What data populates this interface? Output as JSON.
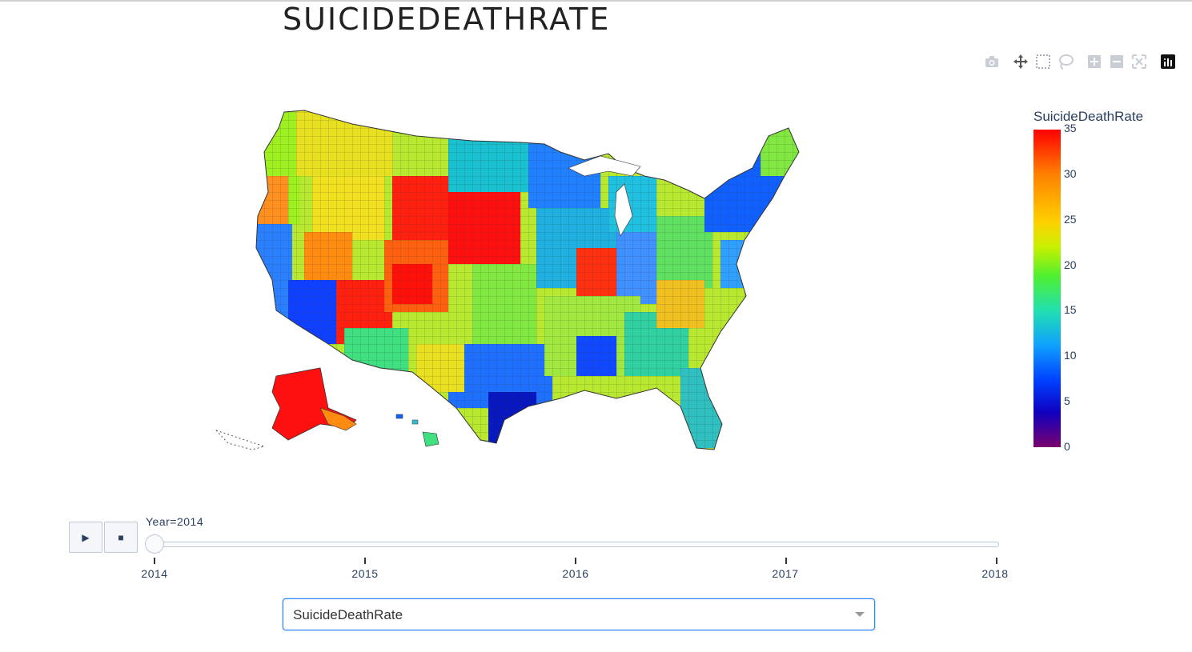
{
  "page": {
    "title": "SUICIDEDEATHRATE"
  },
  "modebar": {
    "buttons": [
      "camera-icon",
      "pan-icon",
      "box-select-icon",
      "lasso-icon",
      "zoom-in-icon",
      "zoom-out-icon",
      "reset-icon",
      "plotly-logo-icon"
    ]
  },
  "colorbar": {
    "title": "SuicideDeathRate",
    "ticks": [
      "35",
      "30",
      "25",
      "20",
      "15",
      "10",
      "5",
      "0"
    ],
    "colors": [
      "#ff0000",
      "#ff8000",
      "#ffd000",
      "#50f030",
      "#20e0b0",
      "#10a0ff",
      "#0040ff",
      "#1000c0",
      "#7a006e"
    ]
  },
  "animation": {
    "play_icon": "▶",
    "stop_icon": "■",
    "current_label": "Year=2014",
    "years": [
      "2014",
      "2015",
      "2016",
      "2017",
      "2018"
    ],
    "current_index": 0
  },
  "dropdown": {
    "value": "SuicideDeathRate"
  },
  "chart_data": {
    "type": "choropleth",
    "title": "SUICIDEDEATHRATE",
    "geography": "US counties",
    "colorbar_title": "SuicideDeathRate",
    "color_range": [
      0,
      35
    ],
    "colorscale": "jet-like (0 purple → blue → cyan → green → yellow → orange → red 35)",
    "frame": "Year=2014"
  }
}
